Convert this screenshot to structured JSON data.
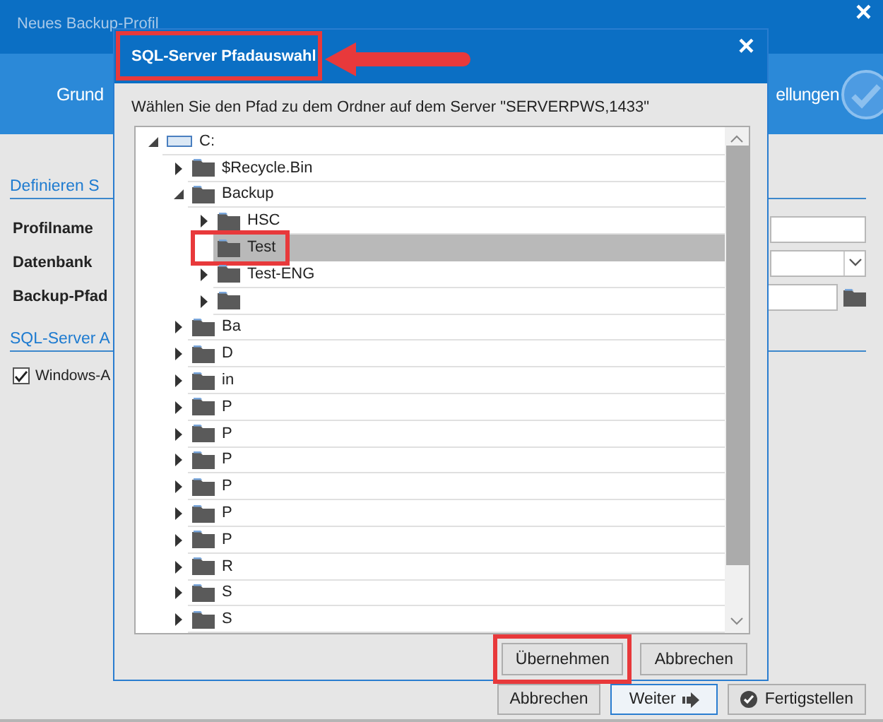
{
  "window": {
    "title": "Neues Backup-Profil",
    "close": "×"
  },
  "steps": [
    {
      "label": "Grund"
    },
    {
      "label": "ellungen"
    }
  ],
  "form": {
    "heading": "Definieren S",
    "fields": [
      {
        "label": "Profilname",
        "kind": "text"
      },
      {
        "label": "Datenbank",
        "kind": "select"
      },
      {
        "label": "Backup-Pfad",
        "kind": "path"
      }
    ]
  },
  "auth": {
    "heading": "SQL-Server A",
    "checkbox": {
      "label": "Windows-A",
      "checked": true
    }
  },
  "buttons": [
    {
      "label": "Abbrechen",
      "kind": "plain"
    },
    {
      "label": "Weiter",
      "kind": "next"
    },
    {
      "label": "Fertigstellen",
      "kind": "finish"
    }
  ],
  "dialog": {
    "title": "SQL-Server Pfadauswahl",
    "title_highlighted": true,
    "title_arrow": true,
    "close": "×",
    "prompt": "Wählen Sie den Pfad zu dem Ordner auf dem Server \"SERVERPWS,1433\"",
    "tree": [
      {
        "label": "C:",
        "kind": "drive",
        "expanded": true,
        "selected": false,
        "highlighted": false,
        "children": [
          {
            "label": "$Recycle.Bin",
            "kind": "folder",
            "expanded": false,
            "selected": false,
            "highlighted": false
          },
          {
            "label": "Backup",
            "kind": "folder",
            "expanded": true,
            "selected": false,
            "highlighted": false,
            "children": [
              {
                "label": "HSC",
                "kind": "folder",
                "expanded": false,
                "selected": false,
                "highlighted": false
              },
              {
                "label": "Test",
                "kind": "leaf",
                "selected": true,
                "highlighted": true
              },
              {
                "label": "Test-ENG",
                "kind": "folder",
                "expanded": false,
                "selected": false,
                "highlighted": false
              },
              {
                "kind": "folder",
                "expanded": false,
                "selected": false,
                "highlighted": false
              }
            ]
          },
          {
            "label": "Ba",
            "kind": "folder",
            "expanded": false,
            "selected": false,
            "highlighted": false
          },
          {
            "label": "D",
            "kind": "folder",
            "expanded": false,
            "selected": false,
            "highlighted": false
          },
          {
            "label": "in",
            "kind": "folder",
            "expanded": false,
            "selected": false,
            "highlighted": false
          },
          {
            "label": "P",
            "kind": "folder",
            "expanded": false,
            "selected": false,
            "highlighted": false
          },
          {
            "label": "P",
            "kind": "folder",
            "expanded": false,
            "selected": false,
            "highlighted": false
          },
          {
            "label": "P",
            "kind": "folder",
            "expanded": false,
            "selected": false,
            "highlighted": false
          },
          {
            "label": "P",
            "kind": "folder",
            "expanded": false,
            "selected": false,
            "highlighted": false
          },
          {
            "label": "P",
            "kind": "folder",
            "expanded": false,
            "selected": false,
            "highlighted": false
          },
          {
            "label": "P",
            "kind": "folder",
            "expanded": false,
            "selected": false,
            "highlighted": false
          },
          {
            "label": "R",
            "kind": "folder",
            "expanded": false,
            "selected": false,
            "highlighted": false
          },
          {
            "label": "S",
            "kind": "folder",
            "expanded": false,
            "selected": false,
            "highlighted": false
          },
          {
            "label": "S",
            "kind": "folder",
            "expanded": false,
            "selected": false,
            "highlighted": false
          }
        ]
      }
    ],
    "buttons": [
      {
        "label": "Übernehmen",
        "highlighted": true
      },
      {
        "label": "Abbrechen",
        "highlighted": false
      }
    ]
  }
}
